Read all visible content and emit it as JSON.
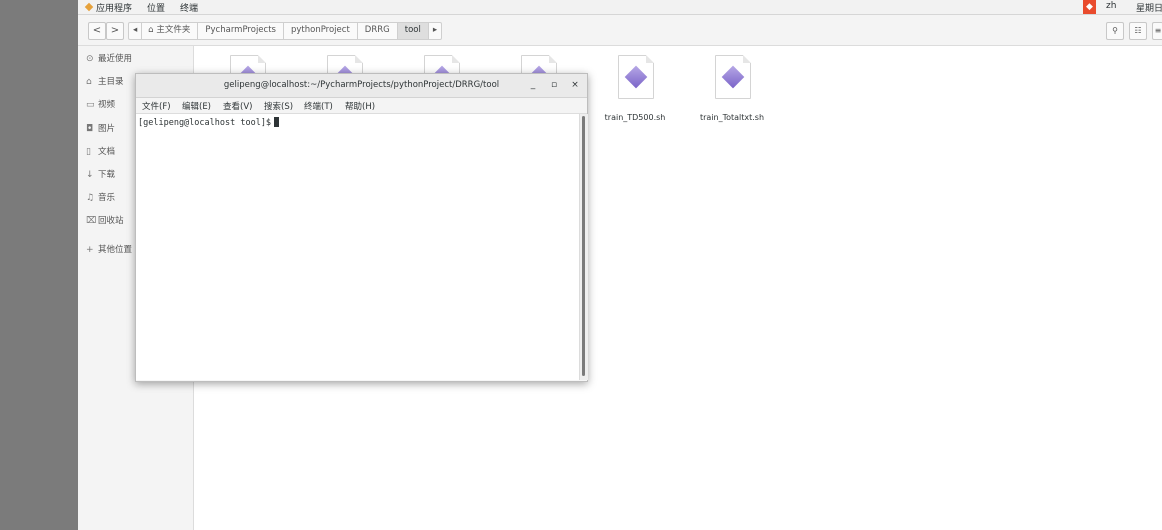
{
  "top_bar": {
    "menus": [
      "应用程序",
      "位置",
      "终端"
    ],
    "ime_label": "zh",
    "day": "星期日"
  },
  "file_manager": {
    "nav": {
      "back": "<",
      "forward": ">",
      "left_arrow": "◂",
      "right_arrow": "▸"
    },
    "breadcrumbs": [
      "主文件夹",
      "PycharmProjects",
      "pythonProject",
      "DRRG",
      "tool"
    ],
    "sidebar": [
      {
        "icon": "clock-icon",
        "glyph": "⊙",
        "label": "最近使用"
      },
      {
        "icon": "home-icon",
        "glyph": "⌂",
        "label": "主目录"
      },
      {
        "icon": "video-icon",
        "glyph": "▭",
        "label": "视频"
      },
      {
        "icon": "camera-icon",
        "glyph": "◘",
        "label": "图片"
      },
      {
        "icon": "document-icon",
        "glyph": "▯",
        "label": "文档"
      },
      {
        "icon": "download-icon",
        "glyph": "↓",
        "label": "下载"
      },
      {
        "icon": "music-icon",
        "glyph": "♫",
        "label": "音乐"
      },
      {
        "icon": "trash-icon",
        "glyph": "⌧",
        "label": "回收站"
      },
      {
        "icon": "plus-icon",
        "glyph": "+",
        "label": "其他位置"
      }
    ],
    "files": [
      {
        "name": "train_TD500.sh"
      },
      {
        "name": "train_Totaltxt.sh"
      }
    ]
  },
  "terminal": {
    "title": "gelipeng@localhost:~/PycharmProjects/pythonProject/DRRG/tool",
    "controls": {
      "minimize": "_",
      "maximize": "▫",
      "close": "×"
    },
    "menus": [
      "文件(F)",
      "编辑(E)",
      "查看(V)",
      "搜索(S)",
      "终端(T)",
      "帮助(H)"
    ],
    "prompt": "[gelipeng@localhost tool]$"
  }
}
